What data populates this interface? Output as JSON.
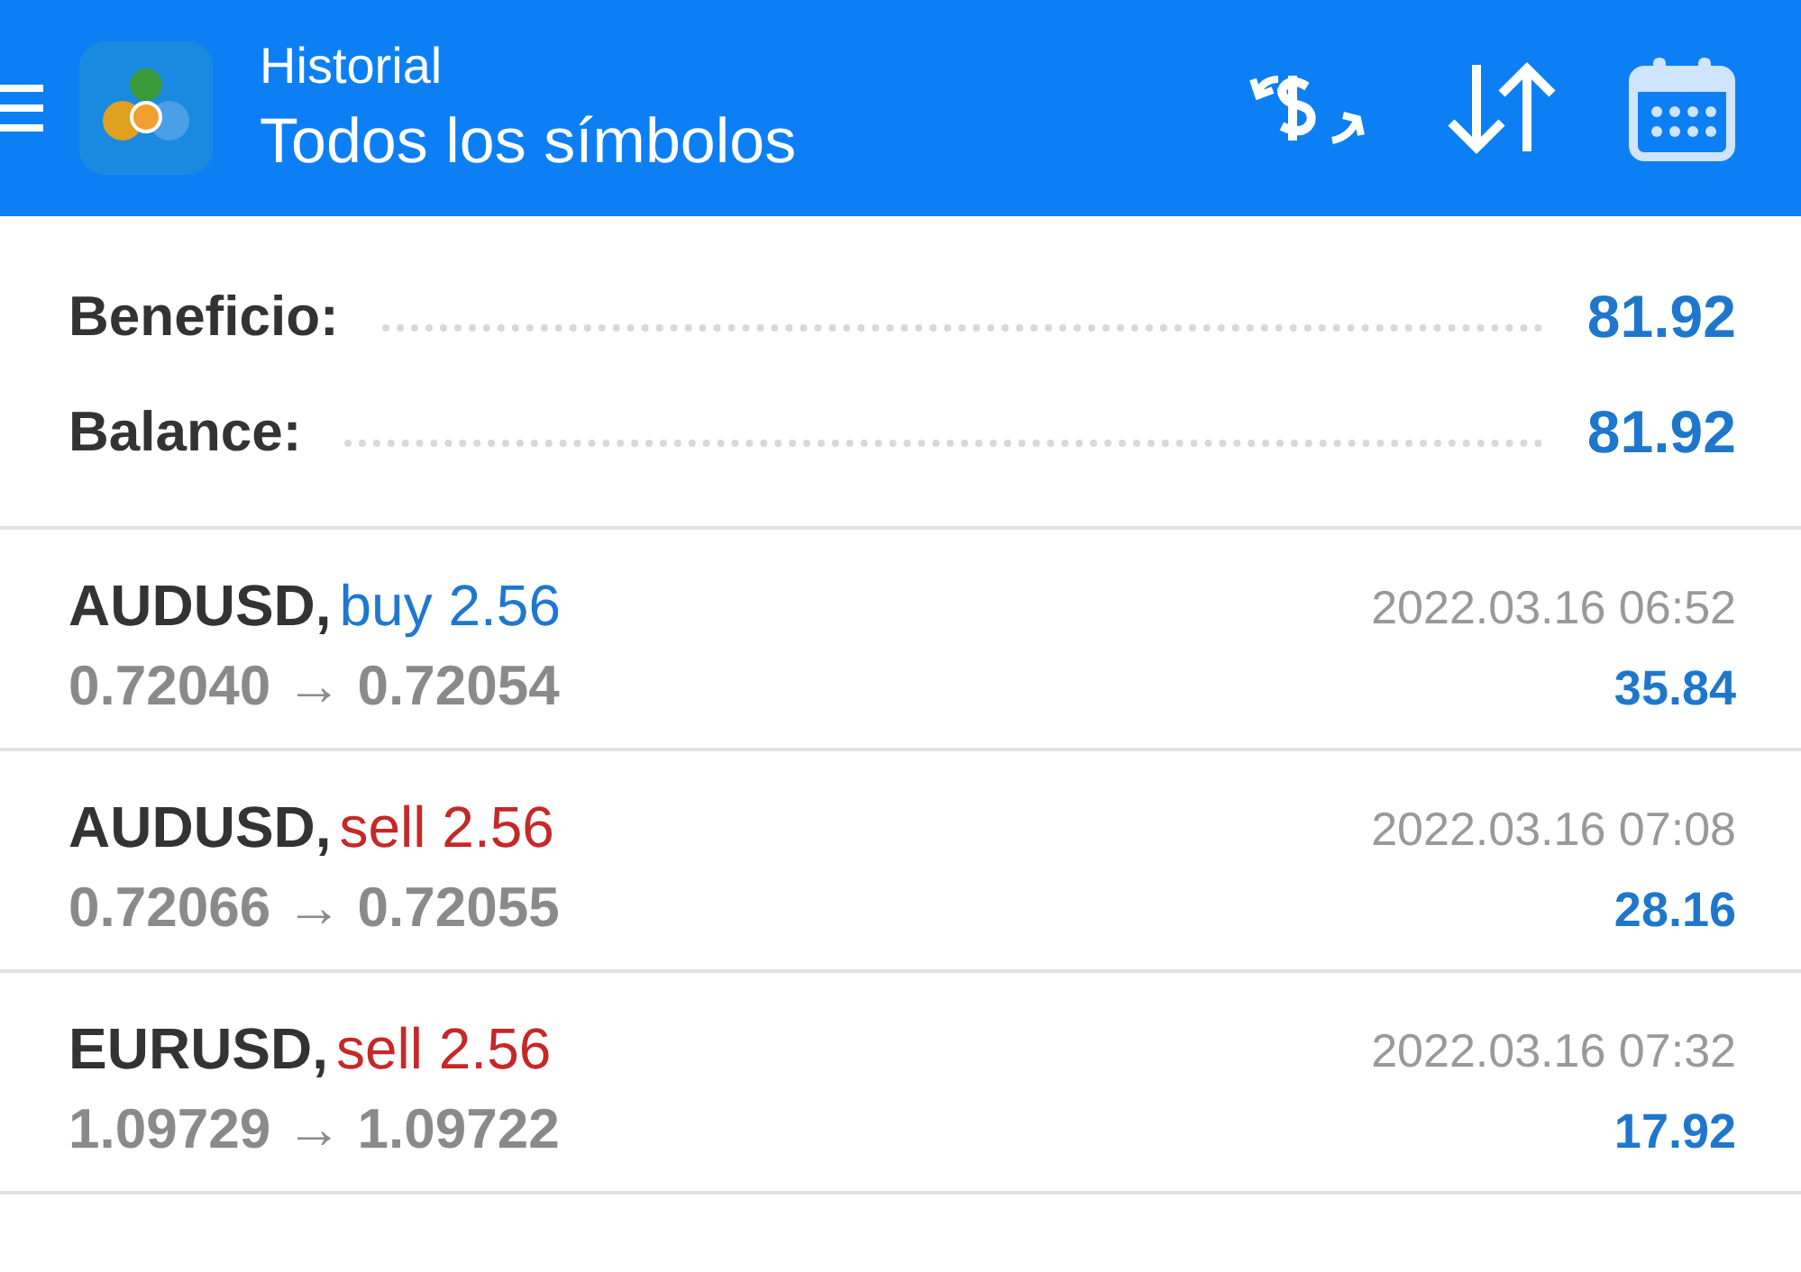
{
  "header": {
    "subtitle": "Historial",
    "title": "Todos los símbolos"
  },
  "summary": [
    {
      "label": "Beneficio:",
      "value": "81.92"
    },
    {
      "label": "Balance:",
      "value": "81.92"
    }
  ],
  "trades": [
    {
      "symbol": "AUDUSD,",
      "type": "buy",
      "volume": "2.56",
      "prices": "0.72040 → 0.72054",
      "time": "2022.03.16 06:52",
      "profit": "35.84"
    },
    {
      "symbol": "AUDUSD,",
      "type": "sell",
      "volume": "2.56",
      "prices": "0.72066 → 0.72055",
      "time": "2022.03.16 07:08",
      "profit": "28.16"
    },
    {
      "symbol": "EURUSD,",
      "type": "sell",
      "volume": "2.56",
      "prices": "1.09729 → 1.09722",
      "time": "2022.03.16 07:32",
      "profit": "17.92"
    }
  ]
}
